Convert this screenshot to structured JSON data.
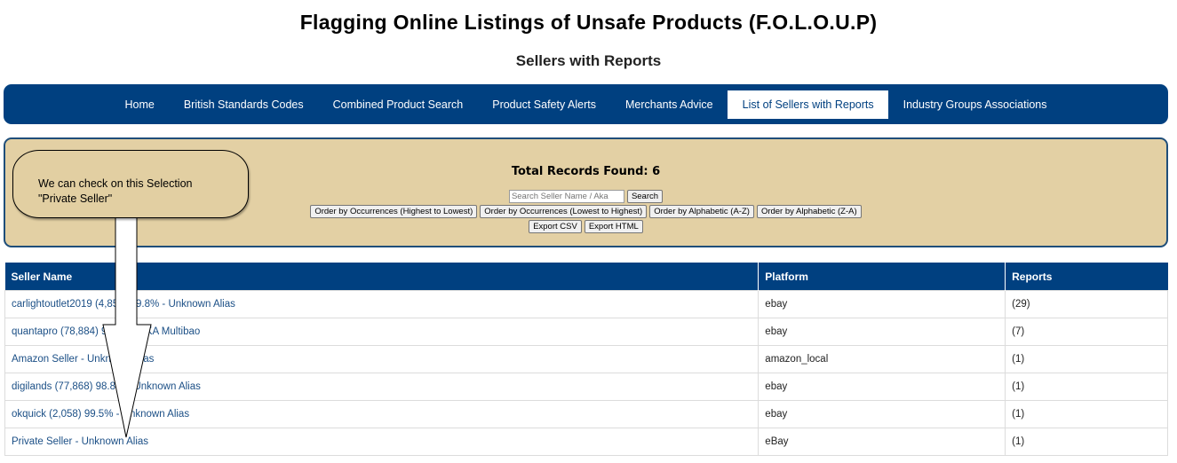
{
  "header": {
    "title": "Flagging Online Listings of Unsafe Products (F.O.L.O.U.P)",
    "subtitle": "Sellers with Reports"
  },
  "nav": {
    "items": [
      {
        "label": "Home"
      },
      {
        "label": "British Standards Codes"
      },
      {
        "label": "Combined Product Search"
      },
      {
        "label": "Product Safety Alerts"
      },
      {
        "label": "Merchants Advice"
      },
      {
        "label": "List of Sellers with Reports",
        "active": true
      },
      {
        "label": "Industry Groups Associations"
      }
    ]
  },
  "filter": {
    "total_label": "Total Records Found:",
    "total_count": "6",
    "search_placeholder": "Search Seller Name / Aka",
    "search_button": "Search",
    "order_buttons": [
      "Order by Occurrences (Highest to Lowest)",
      "Order by Occurrences (Lowest to Highest)",
      "Order by Alphabetic (A-Z)",
      "Order by Alphabetic (Z-A)"
    ],
    "export_csv": "Export CSV",
    "export_html": "Export HTML"
  },
  "table": {
    "headers": [
      "Seller Name",
      "Platform",
      "Reports"
    ],
    "rows": [
      {
        "seller": "carlightoutlet2019 (4,853) 99.8% - Unknown Alias",
        "platform": "ebay",
        "reports": "(29)"
      },
      {
        "seller": "quantapro (78,884) 99.9% - AKA Multibao",
        "platform": "ebay",
        "reports": "(7)"
      },
      {
        "seller": "Amazon Seller - Unknown Alias",
        "platform": "amazon_local",
        "reports": "(1)"
      },
      {
        "seller": "digilands (77,868) 98.8% - Unknown Alias",
        "platform": "ebay",
        "reports": "(1)"
      },
      {
        "seller": "okquick (2,058) 99.5% - Unknown Alias",
        "platform": "ebay",
        "reports": "(1)"
      },
      {
        "seller": "Private Seller - Unknown Alias",
        "platform": "eBay",
        "reports": "(1)"
      }
    ]
  },
  "annotation": {
    "line1": "We can check on this Selection",
    "line2": "\"Private Seller\""
  },
  "colors": {
    "brand_blue": "#004080",
    "panel_tan": "#e3d0a4"
  }
}
